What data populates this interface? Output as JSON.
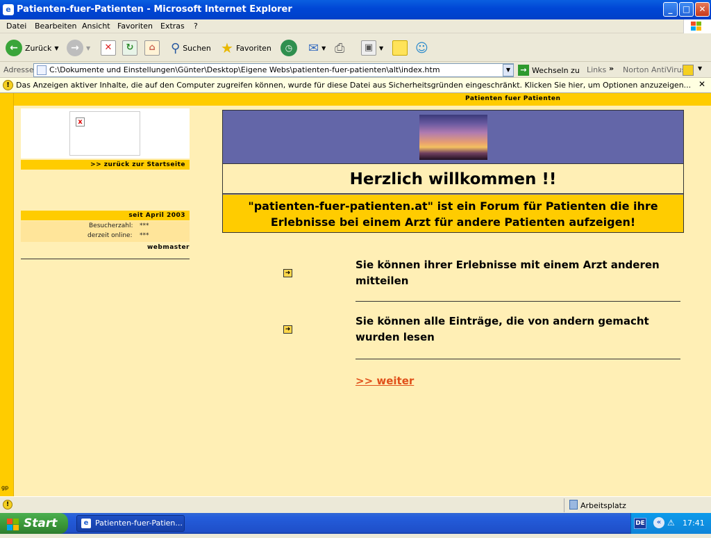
{
  "window": {
    "title": "Patienten-fuer-Patienten - Microsoft Internet Explorer",
    "min": "_",
    "max": "□",
    "close": "✕"
  },
  "menu": [
    "Datei",
    "Bearbeiten",
    "Ansicht",
    "Favoriten",
    "Extras",
    "?"
  ],
  "toolbar": {
    "back": "Zurück",
    "search": "Suchen",
    "favorites": "Favoriten"
  },
  "address": {
    "label": "Adresse",
    "url": "C:\\Dokumente und Einstellungen\\Günter\\Desktop\\Eigene Webs\\patienten-fuer-patienten\\alt\\index.htm",
    "go": "Wechseln zu",
    "links": "Links",
    "norton": "Norton AntiVirus"
  },
  "infobar": {
    "text": "Das Anzeigen aktiver Inhalte, die auf den Computer zugreifen können, wurde für diese Datei aus Sicherheitsgründen eingeschränkt. Klicken Sie hier, um Optionen anzuzeigen...",
    "close": "✕"
  },
  "page": {
    "header": "Patienten fuer Patienten",
    "back_link": ">> zurück zur Startseite",
    "since": "seit April 2003",
    "visitors_label": "Besucherzahl:",
    "visitors_value": "***",
    "online_label": "derzeit online:",
    "online_value": "***",
    "webmaster": "webmaster",
    "welcome": "Herzlich willkommen !!",
    "description_line1": "\"patienten-fuer-patienten.at\" ist ein Forum für Patienten die ihre",
    "description_line2": "Erlebnisse bei einem Arzt für andere Patienten aufzeigen!",
    "item1_line1": "Sie können ihrer Erlebnisse mit einem Arzt anderen",
    "item1_line2": "mitteilen",
    "item2_line1": "Sie können alle Einträge, die von andern gemacht",
    "item2_line2": "wurden lesen",
    "weiter": ">> weiter",
    "corner_mark": "gp"
  },
  "status": {
    "zone": "Arbeitsplatz"
  },
  "taskbar": {
    "start": "Start",
    "item": "Patienten-fuer-Patien...",
    "lang": "DE",
    "clock": "17:41"
  }
}
